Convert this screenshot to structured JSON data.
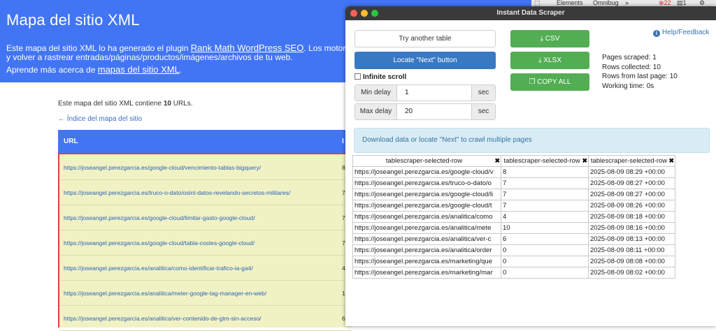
{
  "background_page": {
    "title": "Mapa del sitio XML",
    "intro_prefix": "Este mapa del sitio XML lo ha generado el plugin ",
    "intro_link": "Rank Math WordPress SEO",
    "intro_suffix": ". Los motores de bú",
    "intro_line2": "y volver a rastrear entradas/páginas/productos/imágenes/archivos de tu web.",
    "learn_prefix": "Aprende más acerca de ",
    "learn_link": "mapas del sitio XML",
    "learn_suffix": ".",
    "count_prefix": "Este mapa del sitio XML contiene ",
    "count_value": "10",
    "count_suffix": " URLs.",
    "index_link": "← Índice del mapa del sitio",
    "table_header_url": "URL",
    "table_header_second": "I",
    "rows": [
      {
        "url": "https://joseangel.perezgarcia.es/google-cloud/vencimiento-tablas-bigquery/",
        "num": "8"
      },
      {
        "url": "https://joseangel.perezgarcia.es/truco-o-dato/osint-datos-revelando-secretos-militares/",
        "num": "7"
      },
      {
        "url": "https://joseangel.perezgarcia.es/google-cloud/limitar-gasto-google-cloud/",
        "num": "7"
      },
      {
        "url": "https://joseangel.perezgarcia.es/google-cloud/tabla-costes-google-cloud/",
        "num": "7"
      },
      {
        "url": "https://joseangel.perezgarcia.es/analitica/como-identificar-trafico-ia-ga4/",
        "num": "4"
      },
      {
        "url": "https://joseangel.perezgarcia.es/analitica/meter-google-tag-manager-en-web/",
        "num": "1"
      },
      {
        "url": "https://joseangel.perezgarcia.es/analitica/ver-contenido-de-gtm-sin-acceso/",
        "num": "6"
      }
    ]
  },
  "devtools": {
    "tab_elements": "Elements",
    "tab_omnibug": "Omnibug",
    "more": "»",
    "errors": "22",
    "messages": "1"
  },
  "popup": {
    "window_title": "Instant Data Scraper",
    "try_another_label": "Try another table",
    "locate_next_label": "Locate \"Next\" button",
    "infinite_scroll_label": "Infinite scroll",
    "min_delay_label": "Min delay",
    "min_delay_value": "1",
    "max_delay_label": "Max delay",
    "max_delay_value": "20",
    "delay_unit": "sec",
    "csv_label": "⤓ CSV",
    "xlsx_label": "⤓ XLSX",
    "copy_label": "❐ COPY ALL",
    "help_label": "Help/Feedback",
    "stats": {
      "pages_scraped": "Pages scraped: 1",
      "rows_collected": "Rows collected: 10",
      "rows_last_page": "Rows from last page: 10",
      "working_time": "Working time: 0s"
    },
    "info_message": "Download data or locate \"Next\" to crawl multiple pages",
    "table_headers": [
      "tablescraper-selected-row",
      "tablescraper-selected-row",
      "tablescraper-selected-row"
    ],
    "table_rows": [
      [
        "https://joseangel.perezgarcia.es/google-cloud/v",
        "8",
        "2025-08-09 08:29 +00:00"
      ],
      [
        "https://joseangel.perezgarcia.es/truco-o-dato/o",
        "7",
        "2025-08-09 08:27 +00:00"
      ],
      [
        "https://joseangel.perezgarcia.es/google-cloud/li",
        "7",
        "2025-08-09 08:27 +00:00"
      ],
      [
        "https://joseangel.perezgarcia.es/google-cloud/t",
        "7",
        "2025-08-09 08:26 +00:00"
      ],
      [
        "https://joseangel.perezgarcia.es/analitica/como",
        "4",
        "2025-08-09 08:18 +00:00"
      ],
      [
        "https://joseangel.perezgarcia.es/analitica/mete",
        "10",
        "2025-08-09 08:16 +00:00"
      ],
      [
        "https://joseangel.perezgarcia.es/analitica/ver-c",
        "6",
        "2025-08-09 08:13 +00:00"
      ],
      [
        "https://joseangel.perezgarcia.es/analitica/order",
        "0",
        "2025-08-09 08:11 +00:00"
      ],
      [
        "https://joseangel.perezgarcia.es/marketing/que",
        "0",
        "2025-08-09 08:08 +00:00"
      ],
      [
        "https://joseangel.perezgarcia.es/marketing/mar",
        "0",
        "2025-08-09 08:02 +00:00"
      ]
    ]
  }
}
